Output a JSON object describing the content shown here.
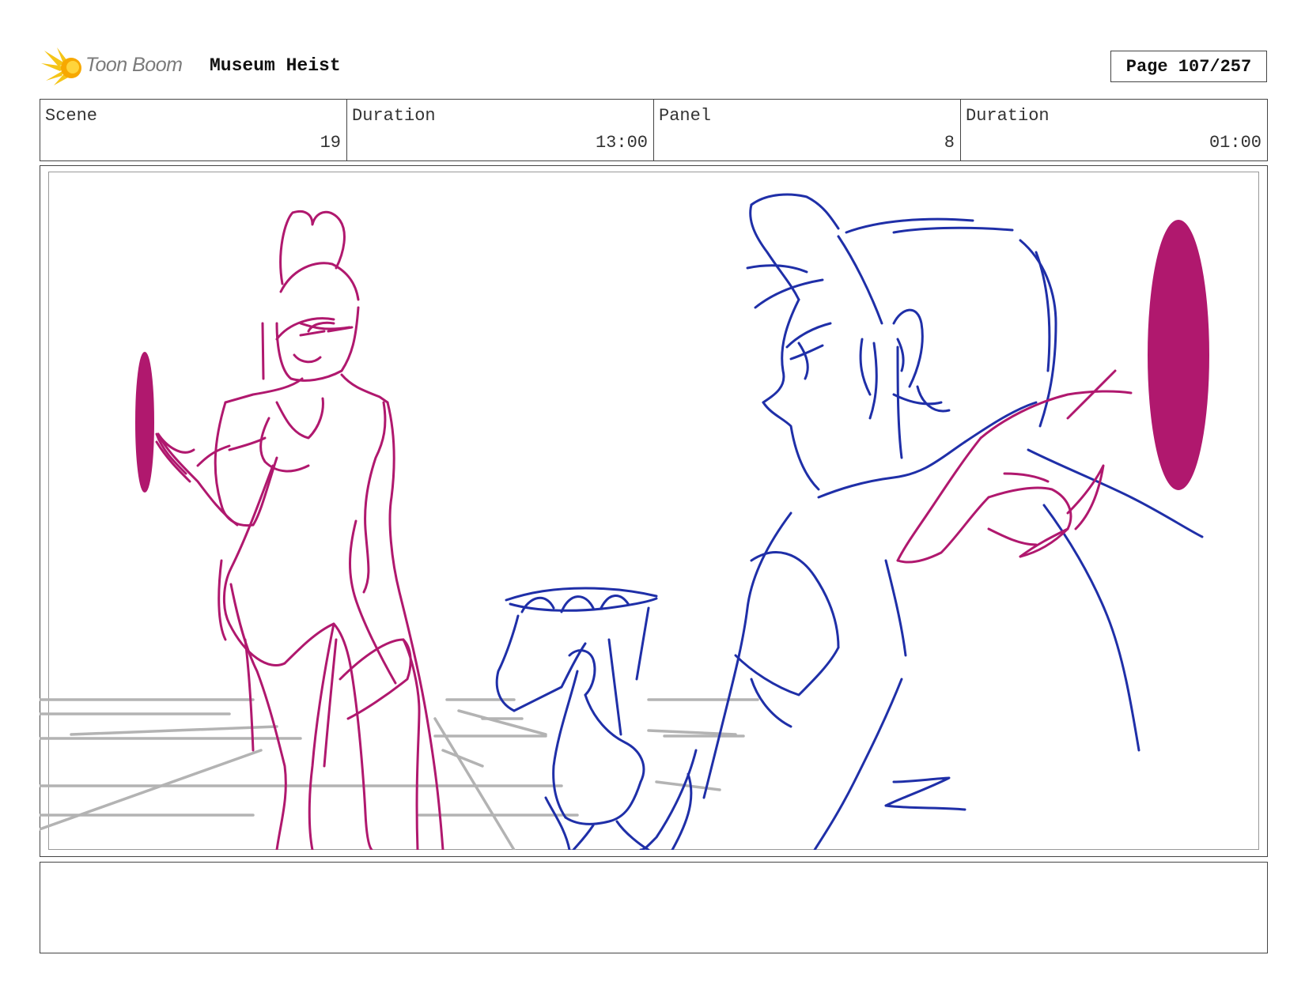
{
  "header": {
    "logo_text": "Toon Boom",
    "project_title": "Museum Heist",
    "page_label": "Page 107/257"
  },
  "info": {
    "scene_label": "Scene",
    "scene_value": "19",
    "scene_duration_label": "Duration",
    "scene_duration_value": "13:00",
    "panel_label": "Panel",
    "panel_value": "8",
    "panel_duration_label": "Duration",
    "panel_duration_value": "01:00"
  },
  "colors": {
    "magenta_character": "#b0186e",
    "blue_character": "#1f2fa8",
    "floor_grid": "#b3b3b3",
    "logo_star": "#f5c518"
  },
  "notes": {
    "text": ""
  }
}
